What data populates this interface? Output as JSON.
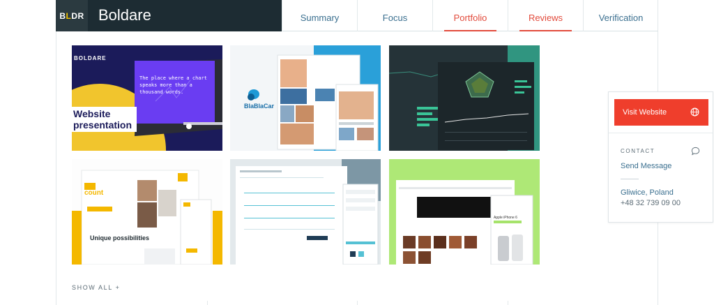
{
  "header": {
    "logo_text": "BLDR",
    "company_name": "Boldare",
    "tabs": [
      {
        "label": "Summary"
      },
      {
        "label": "Focus"
      },
      {
        "label": "Portfolio"
      },
      {
        "label": "Reviews"
      },
      {
        "label": "Verification"
      }
    ]
  },
  "portfolio": {
    "items": [
      {
        "brand": "BOLDARE",
        "headline_1": "Website",
        "headline_2": "presentation",
        "screen_text": "The place where a chart speaks more than a thousand words."
      },
      {
        "brand": "BlaBlaCar"
      },
      {
        "name": "dark-dashboard"
      },
      {
        "headline": "Unique possibilities",
        "brand": "count"
      },
      {
        "name": "booking-interface"
      },
      {
        "name": "ecommerce-shop",
        "product": "Apple iPhone 6"
      }
    ],
    "show_all": "SHOW ALL +"
  },
  "sidebar": {
    "visit_label": "Visit Website",
    "contact_heading": "CONTACT",
    "send_message": "Send Message",
    "location": "Gliwice, Poland",
    "phone": "+48 32 739 09 00"
  },
  "colors": {
    "brand_dark": "#1d2c33",
    "accent_red": "#e24a3b",
    "link_blue": "#3a6f8f",
    "visit_button": "#ef3e2c"
  }
}
